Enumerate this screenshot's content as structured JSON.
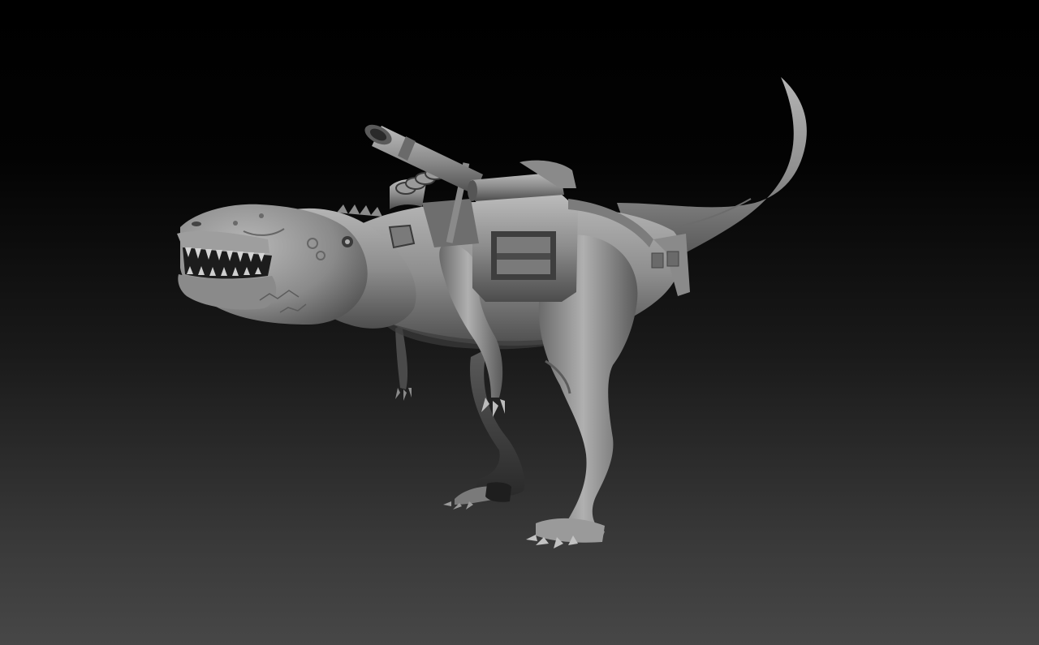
{
  "scene": {
    "subject": "sculpted-dinosaur-with-backpack-cannon",
    "colors": {
      "background_top": "#000000",
      "background_bottom": "#474747",
      "clay_light": "#a8a8a8",
      "clay_mid": "#8a8a8a",
      "clay_dark": "#4a4a4a",
      "clay_shadow": "#2c2c2c"
    }
  }
}
